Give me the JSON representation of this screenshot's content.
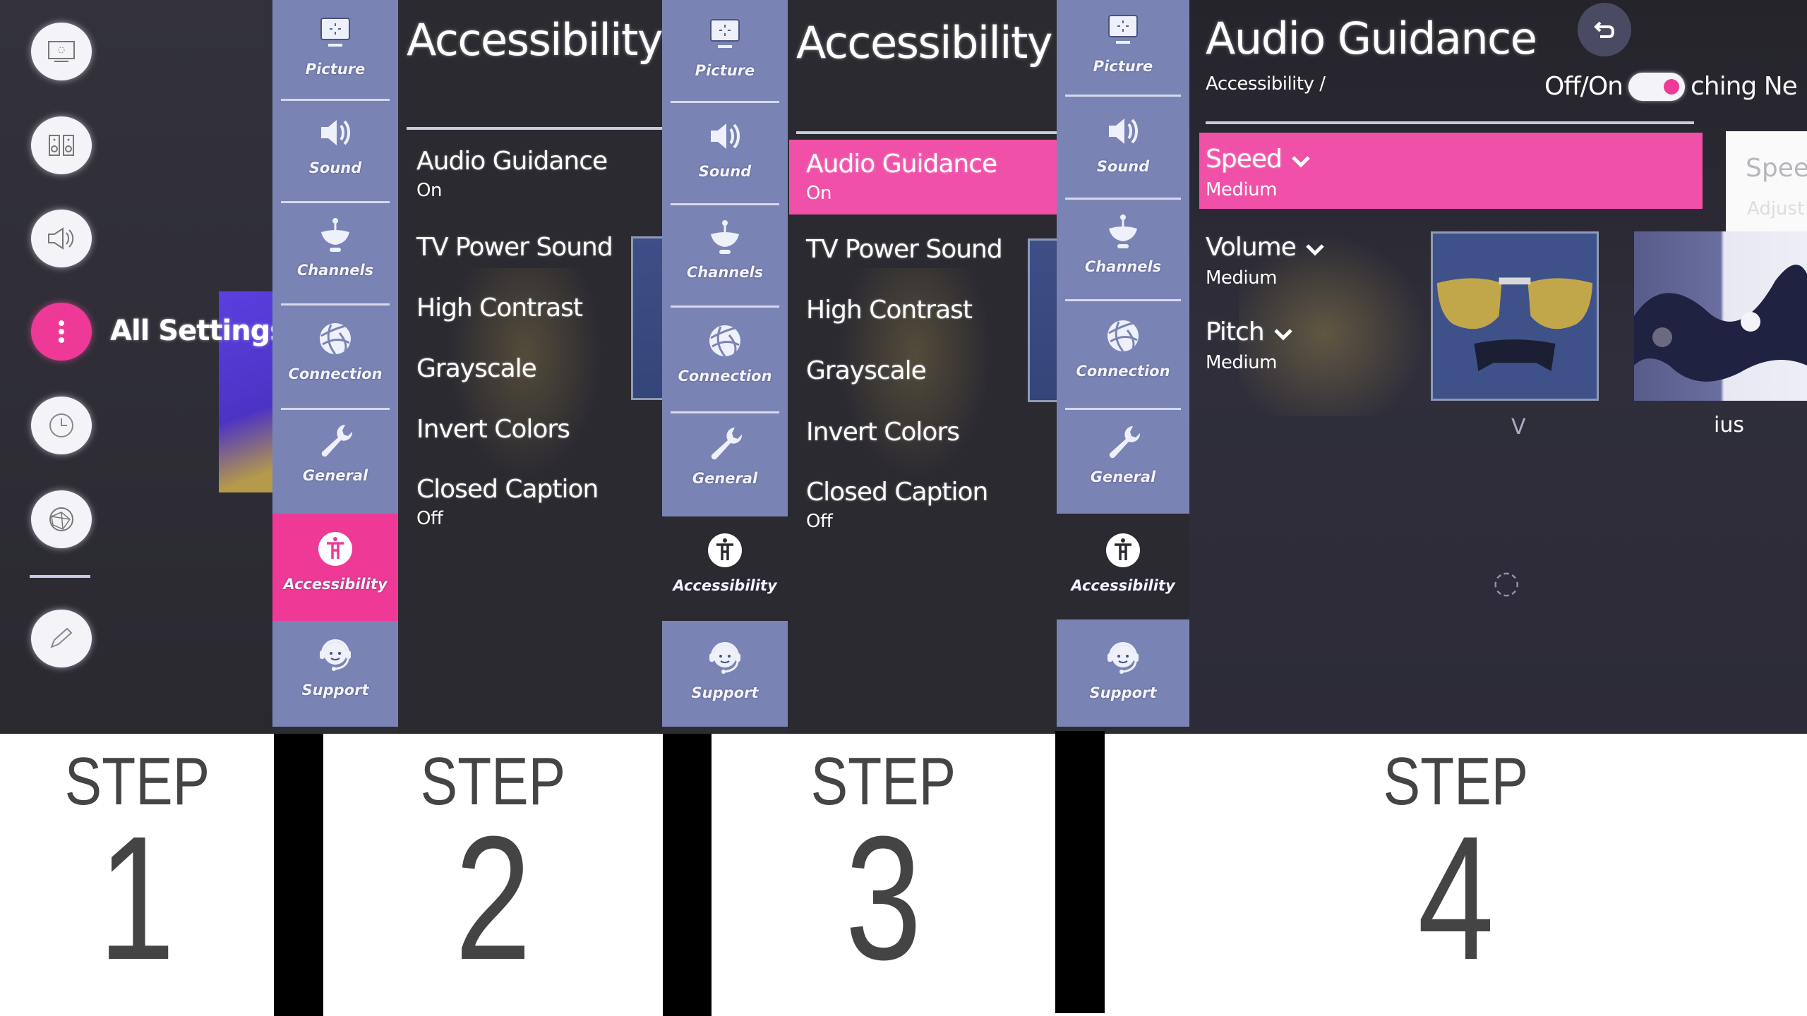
{
  "colors": {
    "accent_pink": "#ee3a96",
    "sidebar_blue": "#7a84b4",
    "menu_bg": "#2b2a31",
    "step_text": "#444444"
  },
  "panel1": {
    "quick_icons": [
      {
        "icon": "picture-icon"
      },
      {
        "icon": "speakers-icon"
      },
      {
        "icon": "sound-icon"
      },
      {
        "icon": "more-icon",
        "label": "All Settings",
        "active": true
      },
      {
        "icon": "clock-icon"
      },
      {
        "icon": "network-icon"
      },
      {
        "icon": "edit-icon"
      }
    ]
  },
  "sidebar": {
    "items": [
      {
        "label": "Picture",
        "icon": "picture-icon"
      },
      {
        "label": "Sound",
        "icon": "sound-icon"
      },
      {
        "label": "Channels",
        "icon": "satellite-dish-icon"
      },
      {
        "label": "Connection",
        "icon": "globe-icon"
      },
      {
        "label": "General",
        "icon": "wrench-icon"
      },
      {
        "label": "Accessibility",
        "icon": "accessibility-icon"
      },
      {
        "label": "Support",
        "icon": "headset-icon"
      }
    ]
  },
  "panel2": {
    "title": "Accessibility",
    "menu": [
      {
        "label": "Audio Guidance",
        "sub": "On"
      },
      {
        "label": "TV Power Sound"
      },
      {
        "label": "High Contrast"
      },
      {
        "label": "Grayscale"
      },
      {
        "label": "Invert Colors"
      },
      {
        "label": "Closed Caption",
        "sub": "Off"
      }
    ]
  },
  "panel3": {
    "title": "Accessibility",
    "selected_index": 0,
    "menu": [
      {
        "label": "Audio Guidance",
        "sub": "On"
      },
      {
        "label": "TV Power Sound"
      },
      {
        "label": "High Contrast"
      },
      {
        "label": "Grayscale"
      },
      {
        "label": "Invert Colors"
      },
      {
        "label": "Closed Caption",
        "sub": "Off"
      }
    ]
  },
  "panel4": {
    "title": "Audio Guidance",
    "breadcrumb": "Accessibility /",
    "toggle_label": "Off/On",
    "toggle_on": true,
    "background_partial_text": "ching Ne",
    "settings": [
      {
        "label": "Speed",
        "value": "Medium",
        "selected": true
      },
      {
        "label": "Volume",
        "value": "Medium"
      },
      {
        "label": "Pitch",
        "value": "Medium"
      }
    ],
    "tooltip_title": "Speed",
    "tooltip_sub": "Adjust",
    "bg_labels": [
      "V",
      "ius"
    ]
  },
  "steps": [
    {
      "word": "STEP",
      "number": "1"
    },
    {
      "word": "STEP",
      "number": "2"
    },
    {
      "word": "STEP",
      "number": "3"
    },
    {
      "word": "STEP",
      "number": "4"
    }
  ]
}
